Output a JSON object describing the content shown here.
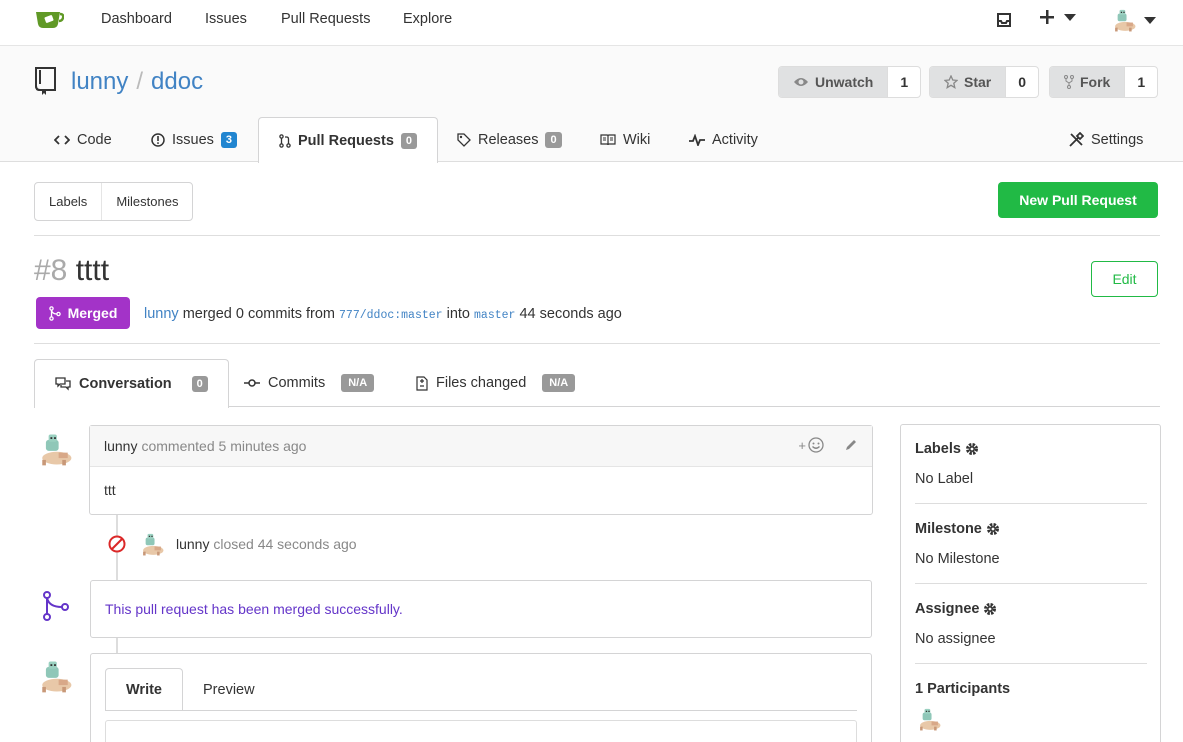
{
  "nav": {
    "items": [
      "Dashboard",
      "Issues",
      "Pull Requests",
      "Explore"
    ]
  },
  "repo": {
    "owner": "lunny",
    "separator": "/",
    "name": "ddoc",
    "unwatch_label": "Unwatch",
    "unwatch_count": "1",
    "star_label": "Star",
    "star_count": "0",
    "fork_label": "Fork",
    "fork_count": "1"
  },
  "tabs": {
    "code": "Code",
    "issues": "Issues",
    "issues_count": "3",
    "pulls": "Pull Requests",
    "pulls_count": "0",
    "releases": "Releases",
    "releases_count": "0",
    "wiki": "Wiki",
    "activity": "Activity",
    "settings": "Settings"
  },
  "submenu": {
    "labels": "Labels",
    "milestones": "Milestones",
    "new_pr": "New Pull Request"
  },
  "pr": {
    "index": "#8",
    "title": "tttt",
    "edit": "Edit",
    "status": "Merged",
    "merger": "lunny",
    "merged_text": "merged 0 commits from",
    "head_branch": "777/ddoc:master",
    "into_text": "into",
    "base_branch": "master",
    "time": "44 seconds ago"
  },
  "prtabs": {
    "conversation": "Conversation",
    "conversation_count": "0",
    "commits": "Commits",
    "commits_count": "N/A",
    "files": "Files changed",
    "files_count": "N/A"
  },
  "comment": {
    "author": "lunny",
    "action": "commented",
    "time": "5 minutes ago",
    "body": "ttt",
    "reaction_plus": "+"
  },
  "event": {
    "author": "lunny",
    "text": "closed",
    "time": "44 seconds ago"
  },
  "merge_message": "This pull request has been merged successfully.",
  "form": {
    "write": "Write",
    "preview": "Preview"
  },
  "sidebar": {
    "labels_title": "Labels",
    "labels_value": "No Label",
    "milestone_title": "Milestone",
    "milestone_value": "No Milestone",
    "assignee_title": "Assignee",
    "assignee_value": "No assignee",
    "participants_title": "1 Participants"
  },
  "colors": {
    "accent": "#4183c4",
    "green": "#21ba45",
    "merged_purple": "#a333c8",
    "merged_text": "#6435c9"
  }
}
